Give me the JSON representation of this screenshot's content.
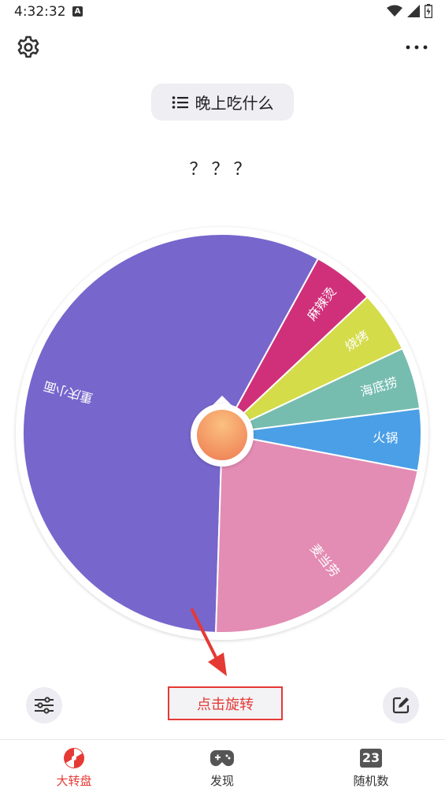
{
  "status_bar": {
    "time": "4:32:32",
    "notif_letter": "A"
  },
  "header": {
    "title": "晚上吃什么",
    "settings_icon": "gear-icon",
    "more_icon": "more-horizontal-icon"
  },
  "result": {
    "text": "？？？"
  },
  "wheel": {
    "segments": [
      {
        "label": "重庆小面",
        "color": "#7766cc",
        "share": 0.575
      },
      {
        "label": "麻辣烫",
        "color": "#d0307a",
        "share": 0.05
      },
      {
        "label": "烧烤",
        "color": "#d4dc4a",
        "share": 0.05
      },
      {
        "label": "海底捞",
        "color": "#76bdb0",
        "share": 0.05
      },
      {
        "label": "火锅",
        "color": "#4a9fe6",
        "share": 0.05
      },
      {
        "label": "麦当劳",
        "color": "#e38cb4",
        "share": 0.225
      }
    ],
    "hub_color": "#f39a5a"
  },
  "actions": {
    "spin_label": "点击旋转",
    "adjust_icon": "sliders-icon",
    "edit_icon": "edit-icon"
  },
  "tabs": [
    {
      "label": "大转盘",
      "icon": "wheel-icon",
      "active": true
    },
    {
      "label": "发现",
      "icon": "gamepad-icon",
      "active": false
    },
    {
      "label": "随机数",
      "icon": "number-icon",
      "badge": "23",
      "active": false
    }
  ],
  "colors": {
    "accent": "#e53935"
  }
}
